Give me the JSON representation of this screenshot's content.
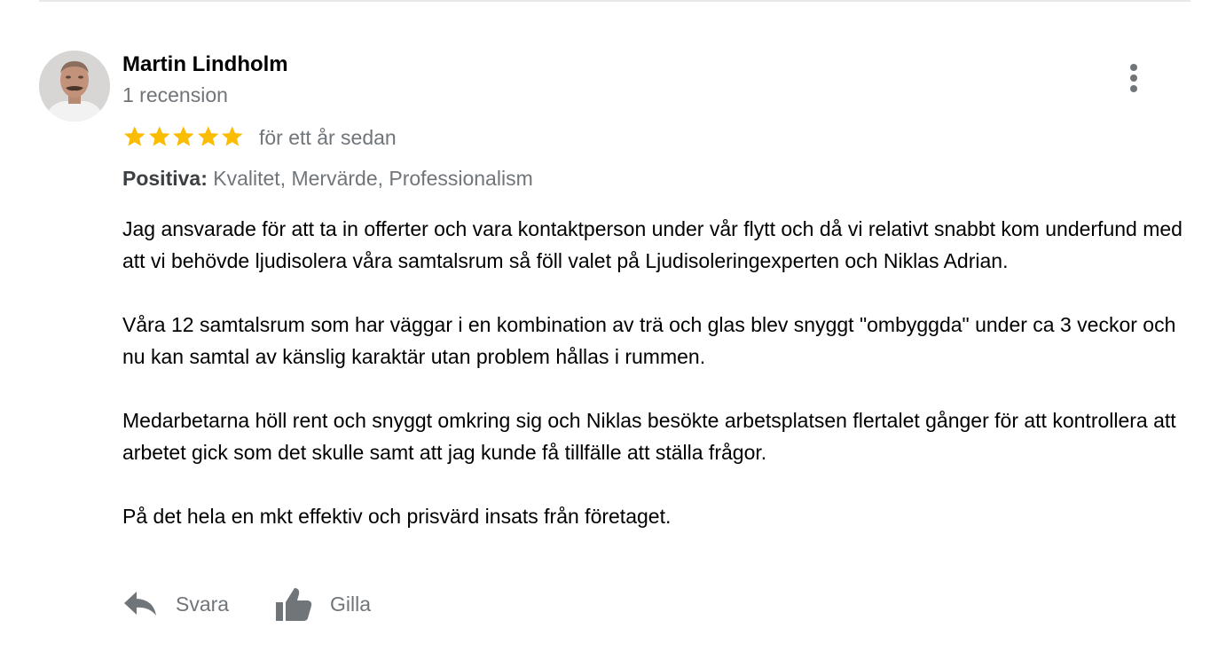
{
  "review": {
    "reviewer_name": "Martin Lindholm",
    "review_count": "1 recension",
    "rating": 5,
    "rating_max": 5,
    "time_ago": "för ett år sedan",
    "positives_label": "Positiva:",
    "positives_values": "Kvalitet, Mervärde, Professionalism",
    "paragraphs": [
      "Jag ansvarade för att ta in offerter och vara kontaktperson under vår flytt och då vi relativt snabbt kom underfund med att vi behövde ljudisolera våra samtalsrum så föll valet på Ljudisoleringexperten och Niklas Adrian.",
      "Våra 12 samtalsrum som har väggar i en kombination av trä och glas blev snyggt \"ombyggda\" under ca 3 veckor och nu kan samtal av känslig karaktär utan problem hållas i rummen.",
      "Medarbetarna höll rent och snyggt omkring sig och Niklas besökte arbetsplatsen flertalet gånger för att kontrollera att arbetet gick som det skulle samt att jag kunde få tillfälle att ställa frågor.",
      "På det hela en mkt effektiv och prisvärd insats från företaget."
    ]
  },
  "actions": {
    "reply_label": "Svara",
    "like_label": "Gilla"
  },
  "icons": {
    "more": "more-vert-icon",
    "reply": "reply-icon",
    "like": "thumbs-up-icon",
    "star": "star-icon"
  },
  "colors": {
    "star": "#fbbc04",
    "secondary_text": "#70757a",
    "icon": "#70757a",
    "divider": "#e8e8e8"
  }
}
